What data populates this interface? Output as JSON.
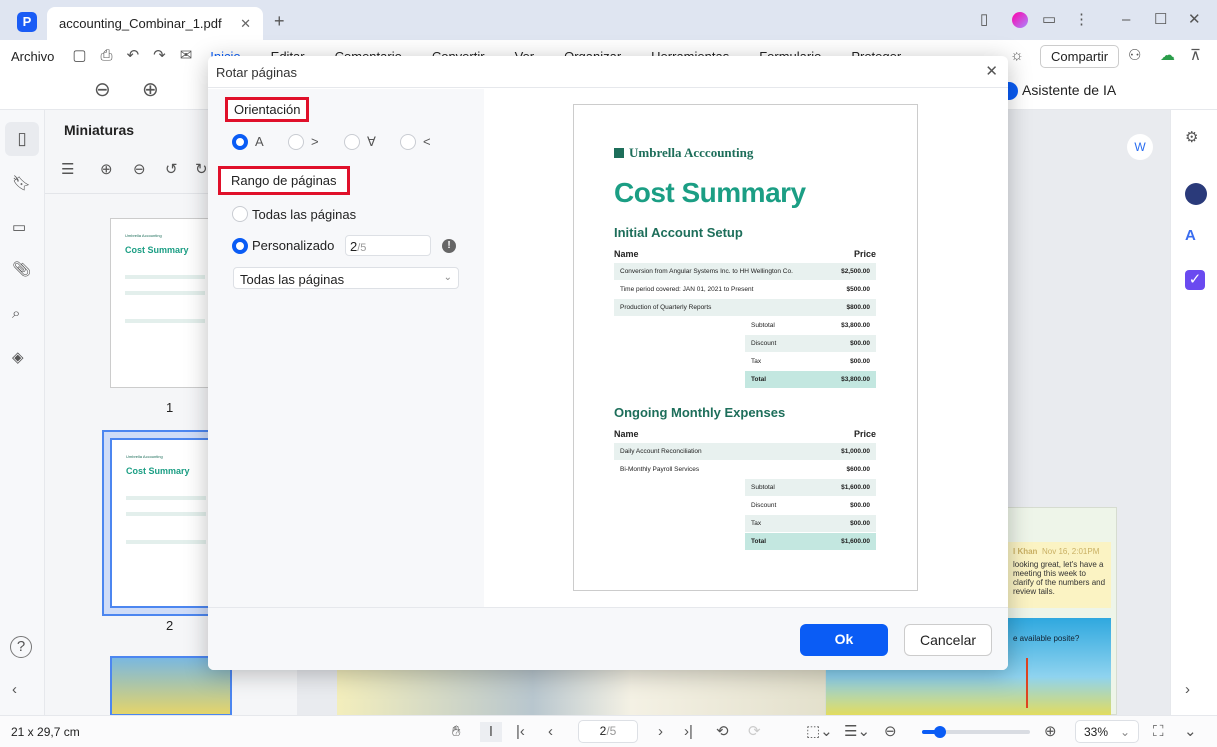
{
  "app": {
    "tab_title": "accounting_Combinar_1.pdf",
    "new_tab": "+"
  },
  "menu": {
    "archivo": "Archivo",
    "items": [
      "Inicio",
      "Editar",
      "Comentario",
      "Convertir",
      "Ver",
      "Organizar",
      "Herramientas",
      "Formulario",
      "Proteger"
    ],
    "share": "Compartir",
    "ai": "Asistente de IA"
  },
  "sidebar": {
    "title": "Miniaturas",
    "pages": [
      "1",
      "2"
    ],
    "thumb_brand": "Umbrella Accounting",
    "thumb_title": "Cost Summary"
  },
  "dialog": {
    "title": "Rotar páginas",
    "orientation_label": "Orientación",
    "orientation_options": [
      "A",
      "ᗅ>",
      "∀",
      "<"
    ],
    "range_label": "Rango de páginas",
    "all_pages": "Todas las páginas",
    "custom": "Personalizado",
    "custom_value": "2",
    "custom_total": "/5",
    "subset_select": "Todas las páginas",
    "ok": "Ok",
    "cancel": "Cancelar"
  },
  "preview": {
    "brand": "Umbrella Acccounting",
    "title": "Cost Summary",
    "sections": [
      {
        "heading": "Initial Account Setup",
        "col_name": "Name",
        "col_price": "Price",
        "rows": [
          [
            "Conversion from Angular Systems Inc. to HH Wellington Co.",
            "$2,500.00"
          ],
          [
            "Time period covered: JAN 01, 2021 to Present",
            "$500.00"
          ],
          [
            "Production of Quarterly Reports",
            "$800.00"
          ]
        ],
        "totals": [
          [
            "Subtotal",
            "$3,800.00"
          ],
          [
            "Discount",
            "$00.00"
          ],
          [
            "Tax",
            "$00.00"
          ],
          [
            "Total",
            "$3,800.00"
          ]
        ]
      },
      {
        "heading": "Ongoing Monthly Expenses",
        "col_name": "Name",
        "col_price": "Price",
        "rows": [
          [
            "Daily Account Reconciliation",
            "$1,000.00"
          ],
          [
            "Bi-Monthly Payroll Services",
            "$600.00"
          ]
        ],
        "totals": [
          [
            "Subtotal",
            "$1,600.00"
          ],
          [
            "Discount",
            "$00.00"
          ],
          [
            "Tax",
            "$00.00"
          ],
          [
            "Total",
            "$1,600.00"
          ]
        ]
      }
    ]
  },
  "background_doc": {
    "comment_author": "l Khan",
    "comment_date": "Nov 16, 2:01PM",
    "comment_text": "looking great, let's have a meeting this week to clarify of the numbers and review tails.",
    "callout": "e available posite?"
  },
  "status": {
    "page_size": "21 x 29,7 cm",
    "page_current": "2",
    "page_total": "/5",
    "zoom": "33%",
    "zoom_slider_percent": 33
  },
  "colors": {
    "accent": "#0a5cf5",
    "highlight": "#e0102a",
    "brand_green": "#1b9e84"
  }
}
